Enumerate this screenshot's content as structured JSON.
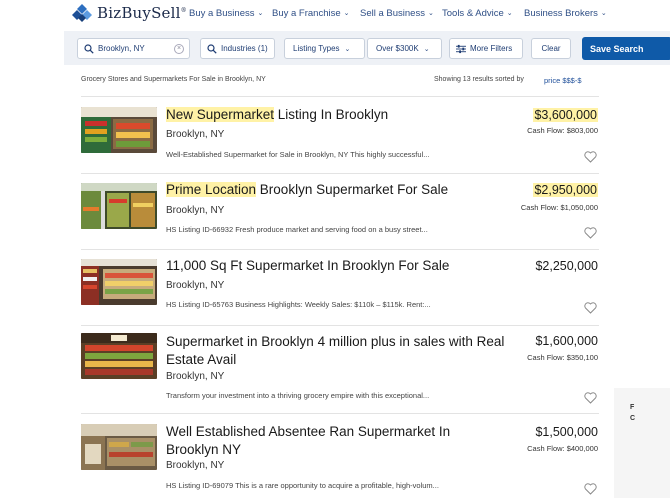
{
  "brand": {
    "name": "BizBuySell",
    "mark": "®"
  },
  "nav": {
    "items": [
      {
        "label": "Buy a Business"
      },
      {
        "label": "Buy a Franchise"
      },
      {
        "label": "Sell a Business"
      },
      {
        "label": "Tools & Advice"
      },
      {
        "label": "Business Brokers"
      }
    ]
  },
  "filters": {
    "location_value": "Brooklyn, NY",
    "industries": "Industries (1)",
    "listing_types": "Listing Types",
    "price": "Over $300K",
    "more_filters": "More Filters",
    "clear": "Clear",
    "save_search": "Save Search"
  },
  "results": {
    "breadcrumb": "Grocery Stores and Supermarkets For Sale in Brooklyn, NY",
    "showing_text": "Showing 13 results sorted by",
    "sort_value": "price $$$-$"
  },
  "listings": [
    {
      "title_highlight": "New Supermarket",
      "title_rest": " Listing In Brooklyn",
      "location": "Brooklyn, NY",
      "description": "Well-Established Supermarket for Sale in Brooklyn, NY This highly successful...",
      "price": "$3,600,000",
      "price_highlighted": true,
      "cash_flow": "Cash Flow: $803,000"
    },
    {
      "title_highlight": "Prime Location",
      "title_rest": " Brooklyn Supermarket For Sale",
      "location": "Brooklyn, NY",
      "description": "HS Listing ID-66932 Fresh produce market and serving food on a busy street...",
      "price": "$2,950,000",
      "price_highlighted": true,
      "cash_flow": "Cash Flow: $1,050,000"
    },
    {
      "title_highlight": "",
      "title_rest": "11,000 Sq Ft Supermarket In Brooklyn For Sale",
      "location": "Brooklyn, NY",
      "description": "HS Listing ID-65763 Business Highlights: Weekly Sales: $110k – $115k. Rent:...",
      "price": "$2,250,000",
      "price_highlighted": false,
      "cash_flow": ""
    },
    {
      "title_highlight": "",
      "title_rest": "Supermarket in Brooklyn 4 million plus in sales with Real Estate Avail",
      "location": "Brooklyn, NY",
      "description": "Transform your investment into a thriving grocery empire with this exceptional...",
      "price": "$1,600,000",
      "price_highlighted": false,
      "cash_flow": "Cash Flow: $350,100"
    },
    {
      "title_highlight": "",
      "title_rest": "Well Established Absentee Ran Supermarket In Brooklyn NY",
      "location": "Brooklyn, NY",
      "description": "HS Listing ID-69079 This is a rare opportunity to acquire a profitable, high-volum...",
      "price": "$1,500,000",
      "price_highlighted": false,
      "cash_flow": "Cash Flow: $400,000"
    }
  ],
  "side_fragments": [
    "F",
    "C"
  ],
  "colors": {
    "nav_link": "#2f4f86",
    "primary_button": "#0f5aa8",
    "highlight": "#fff2a6",
    "filter_bar_bg": "#eef1f6"
  },
  "icons": [
    "bizbuysell-logo-icon",
    "chevron-down-icon",
    "search-icon",
    "clear-icon",
    "sliders-icon",
    "heart-icon"
  ]
}
